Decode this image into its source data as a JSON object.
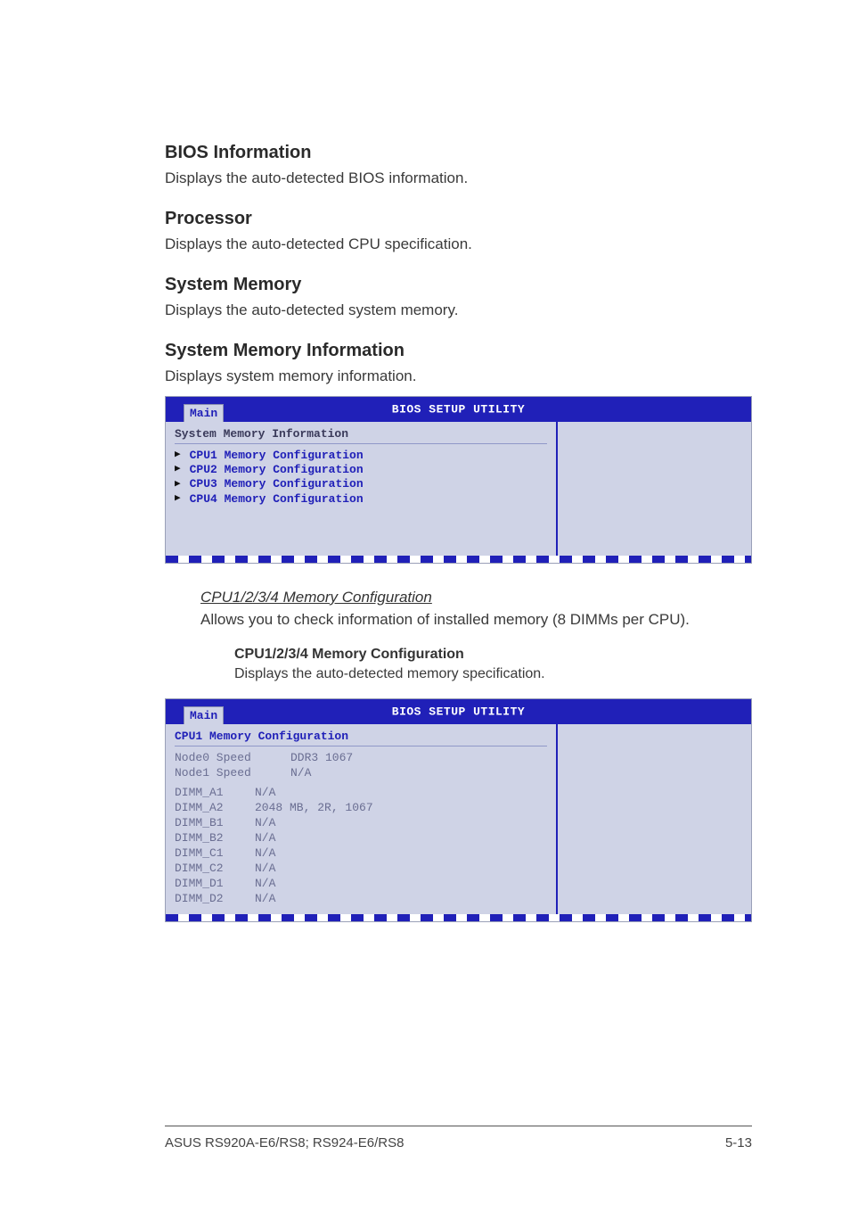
{
  "sections": {
    "bios_info": {
      "heading": "BIOS Information",
      "text": "Displays the auto-detected BIOS information."
    },
    "processor": {
      "heading": "Processor",
      "text": "Displays the auto-detected CPU specification."
    },
    "system_memory": {
      "heading": "System Memory",
      "text": "Displays the auto-detected system memory."
    },
    "sys_mem_info": {
      "heading": "System Memory Information",
      "text": "Displays system memory information."
    }
  },
  "bios1": {
    "title": "BIOS SETUP UTILITY",
    "tab": "Main",
    "panel_title": "System Memory Information",
    "items": [
      "CPU1 Memory Configuration",
      "CPU2 Memory Configuration",
      "CPU3 Memory Configuration",
      "CPU4 Memory Configuration"
    ]
  },
  "mid": {
    "submenu_heading": "CPU1/2/3/4 Memory Configuration",
    "submenu_text": "Allows you to check information of installed memory (8 DIMMs per CPU).",
    "sub2_heading": "CPU1/2/3/4 Memory Configuration",
    "sub2_text": "Displays the auto-detected memory specification."
  },
  "bios2": {
    "title": "BIOS SETUP UTILITY",
    "tab": "Main",
    "panel_title": "CPU1 Memory Configuration",
    "nodes": [
      {
        "k": "Node0 Speed",
        "v": "DDR3 1067"
      },
      {
        "k": "Node1 Speed",
        "v": "N/A"
      }
    ],
    "dimms": [
      {
        "k": "DIMM_A1",
        "v": "N/A"
      },
      {
        "k": "DIMM_A2",
        "v": "2048 MB, 2R, 1067"
      },
      {
        "k": "DIMM_B1",
        "v": "N/A"
      },
      {
        "k": "DIMM_B2",
        "v": "N/A"
      },
      {
        "k": "DIMM_C1",
        "v": "N/A"
      },
      {
        "k": "DIMM_C2",
        "v": "N/A"
      },
      {
        "k": "DIMM_D1",
        "v": "N/A"
      },
      {
        "k": "DIMM_D2",
        "v": "N/A"
      }
    ]
  },
  "footer": {
    "left": "ASUS RS920A-E6/RS8; RS924-E6/RS8",
    "right": "5-13"
  }
}
